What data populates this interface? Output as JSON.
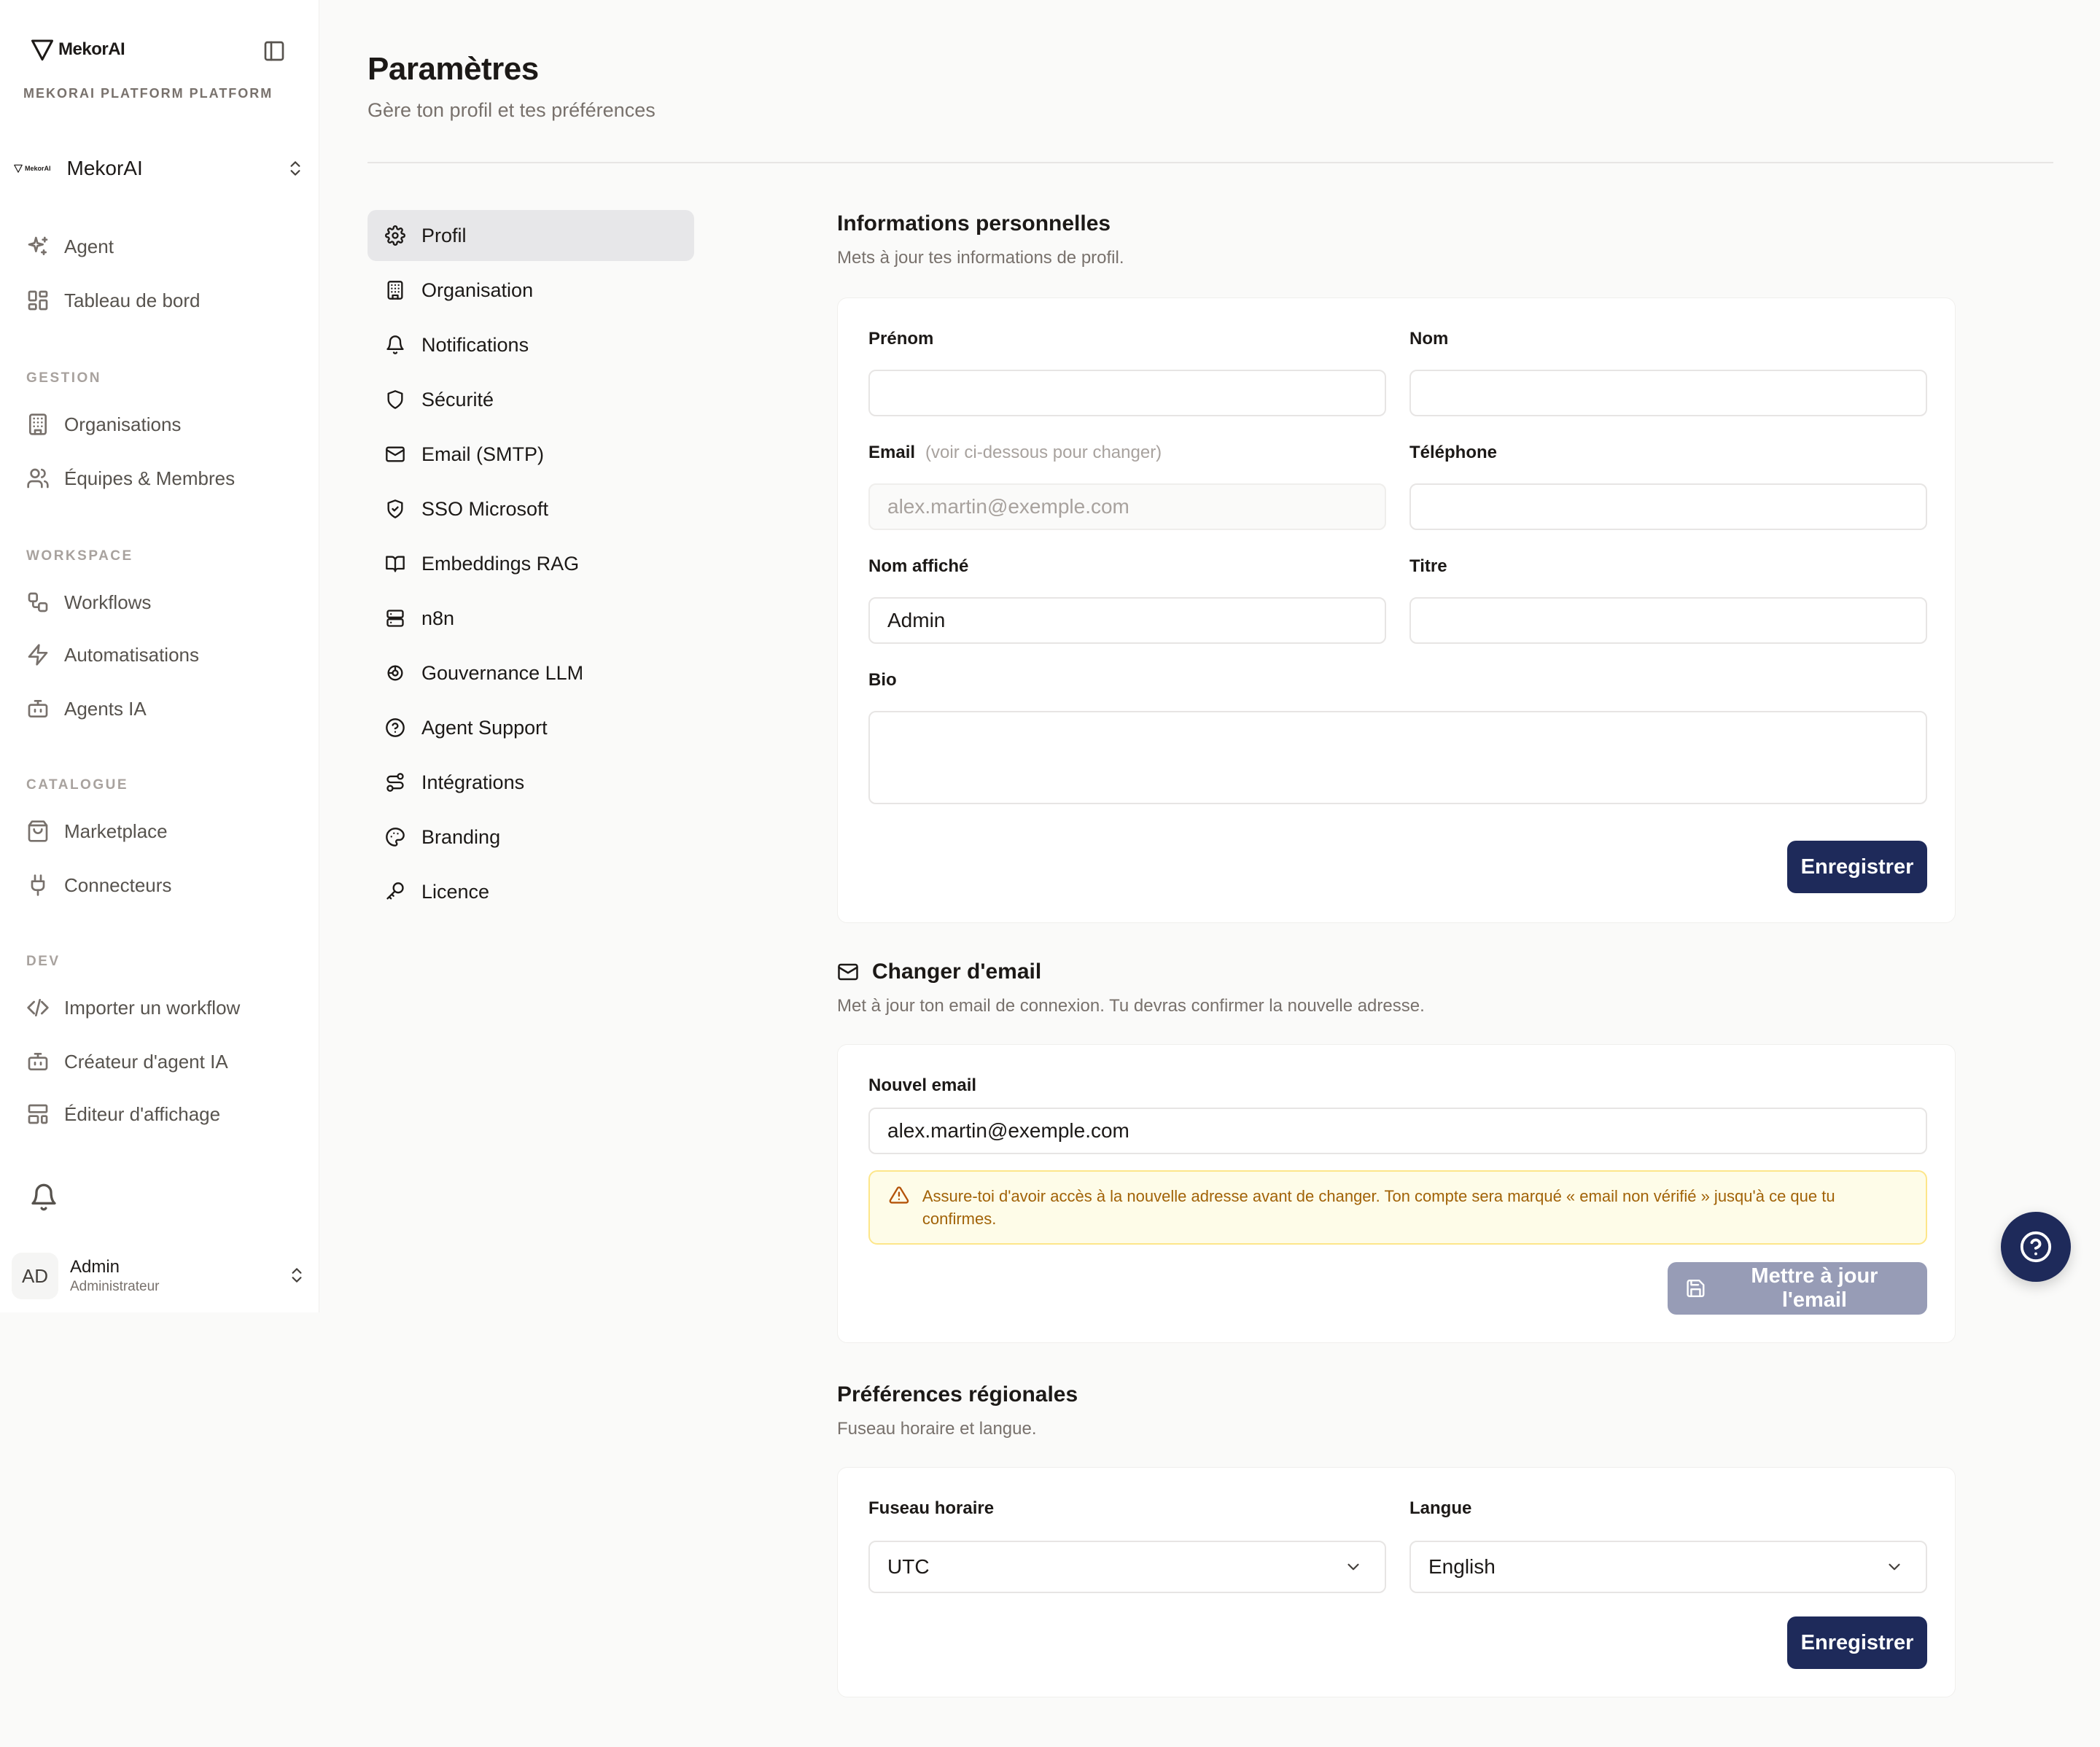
{
  "brand": {
    "name": "MekorAI",
    "platform_label": "MEKORAI PLATFORM PLATFORM"
  },
  "org_switcher": {
    "mini_logo": "MekorAI",
    "name": "MekorAI"
  },
  "sidebar": {
    "top_items": [
      {
        "label": "Agent",
        "icon": "sparkles-icon"
      },
      {
        "label": "Tableau de bord",
        "icon": "dashboard-icon"
      }
    ],
    "sections": [
      {
        "label": "GESTION",
        "items": [
          {
            "label": "Organisations",
            "icon": "building-icon"
          },
          {
            "label": "Équipes & Membres",
            "icon": "users-icon"
          }
        ]
      },
      {
        "label": "WORKSPACE",
        "items": [
          {
            "label": "Workflows",
            "icon": "workflow-icon"
          },
          {
            "label": "Automatisations",
            "icon": "zap-icon"
          },
          {
            "label": "Agents IA",
            "icon": "bot-icon"
          }
        ]
      },
      {
        "label": "CATALOGUE",
        "items": [
          {
            "label": "Marketplace",
            "icon": "shopping-bag-icon"
          },
          {
            "label": "Connecteurs",
            "icon": "plug-icon"
          }
        ]
      },
      {
        "label": "DEV",
        "items": [
          {
            "label": "Importer un workflow",
            "icon": "code-icon"
          },
          {
            "label": "Créateur d'agent IA",
            "icon": "bot-icon"
          },
          {
            "label": "Éditeur d'affichage",
            "icon": "layout-icon"
          }
        ]
      }
    ]
  },
  "user": {
    "initials": "AD",
    "name": "Admin",
    "role": "Administrateur"
  },
  "header": {
    "title": "Paramètres",
    "subtitle": "Gère ton profil et tes préférences"
  },
  "settings_nav": [
    {
      "label": "Profil",
      "icon": "gear-icon",
      "active": true
    },
    {
      "label": "Organisation",
      "icon": "building-icon"
    },
    {
      "label": "Notifications",
      "icon": "bell-icon"
    },
    {
      "label": "Sécurité",
      "icon": "shield-icon"
    },
    {
      "label": "Email (SMTP)",
      "icon": "mail-icon"
    },
    {
      "label": "SSO Microsoft",
      "icon": "shield-check-icon"
    },
    {
      "label": "Embeddings RAG",
      "icon": "book-icon"
    },
    {
      "label": "n8n",
      "icon": "server-icon"
    },
    {
      "label": "Gouvernance LLM",
      "icon": "brain-icon"
    },
    {
      "label": "Agent Support",
      "icon": "help-circle-icon"
    },
    {
      "label": "Intégrations",
      "icon": "route-icon"
    },
    {
      "label": "Branding",
      "icon": "palette-icon"
    },
    {
      "label": "Licence",
      "icon": "key-icon"
    }
  ],
  "personal": {
    "title": "Informations personnelles",
    "subtitle": "Mets à jour tes informations de profil.",
    "first_name_label": "Prénom",
    "first_name_value": "",
    "last_name_label": "Nom",
    "last_name_value": "",
    "email_label": "Email",
    "email_hint": "(voir ci-dessous pour changer)",
    "email_value": "alex.martin@exemple.com",
    "phone_label": "Téléphone",
    "phone_value": "",
    "display_name_label": "Nom affiché",
    "display_name_value": "Admin",
    "job_title_label": "Titre",
    "job_title_value": "",
    "bio_label": "Bio",
    "bio_value": "",
    "save_label": "Enregistrer"
  },
  "change_email": {
    "title": "Changer d'email",
    "subtitle": "Met à jour ton email de connexion. Tu devras confirmer la nouvelle adresse.",
    "new_email_label": "Nouvel email",
    "new_email_value": "alex.martin@exemple.com",
    "warning": "Assure-toi d'avoir accès à la nouvelle adresse avant de changer. Ton compte sera marqué « email non vérifié » jusqu'à ce que tu confirmes.",
    "update_label": "Mettre à jour l'email"
  },
  "regional": {
    "title": "Préférences régionales",
    "subtitle": "Fuseau horaire et langue.",
    "timezone_label": "Fuseau horaire",
    "timezone_value": "UTC",
    "language_label": "Langue",
    "language_value": "English",
    "save_label": "Enregistrer"
  }
}
